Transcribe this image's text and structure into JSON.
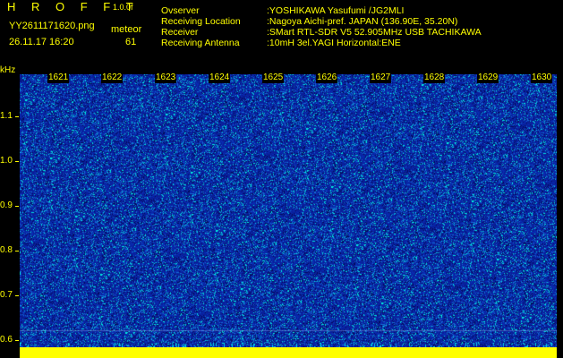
{
  "header": {
    "app_title": "H R O F F T",
    "version": "1.0.0f",
    "filename": "YY2611171620.png",
    "datetime": "26.11.17 16:20",
    "event_type": "meteor",
    "event_count": "61"
  },
  "info": [
    {
      "key": "Ovserver",
      "value": ":YOSHIKAWA Yasufumi /JG2MLI"
    },
    {
      "key": "Receiving Location",
      "value": ":Nagoya Aichi-pref. JAPAN (136.90E, 35.20N)"
    },
    {
      "key": "Receiver",
      "value": ":SMart RTL-SDR V5 52.905MHz USB TACHIKAWA"
    },
    {
      "key": "Receiving Antenna",
      "value": ":10mH 3el.YAGI Horizontal:ENE"
    }
  ],
  "yaxis": {
    "unit": "kHz",
    "labels": [
      "1.1",
      "1.0",
      "0.9",
      "0.8",
      "0.7",
      "0.6"
    ]
  },
  "time_labels": [
    "1621",
    "1622",
    "1623",
    "1624",
    "1625",
    "1626",
    "1627",
    "1628",
    "1629",
    "1630"
  ],
  "colors": {
    "background": "#000000",
    "text": "#ffff00",
    "noise_base": "#0a1f9a",
    "noise_hot": "#00e0e0"
  }
}
